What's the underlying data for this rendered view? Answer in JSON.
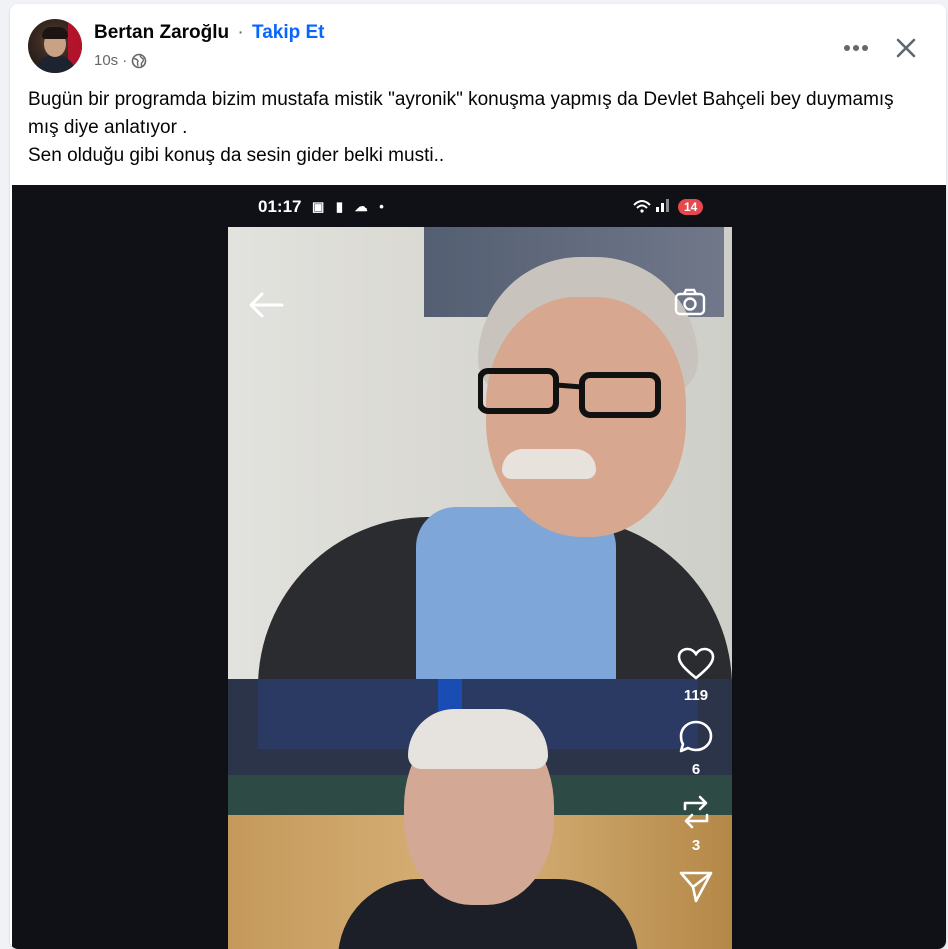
{
  "post": {
    "author": "Bertan Zaroğlu",
    "separator": "·",
    "follow_label": "Takip Et",
    "time": "10s",
    "time_separator": "·",
    "privacy_icon": "globe-icon",
    "text": "Bugün bir programda bizim mustafa mistik  \"ayronik\" konuşma yapmış da Devlet Bahçeli bey duymamış mış diye anlatıyor .\nSen olduğu gibi konuş da sesin gider belki musti.."
  },
  "header_actions": {
    "more_icon": "more-horizontal-icon",
    "close_icon": "close-icon"
  },
  "phone": {
    "status_time": "01:17",
    "status_battery": "14",
    "back_icon": "back-arrow-icon",
    "camera_icon": "camera-switch-icon",
    "likes": "119",
    "comments": "6",
    "reposts": "3",
    "actions_icons": [
      "heart-icon",
      "comment-icon",
      "repost-icon",
      "share-icon"
    ]
  },
  "colors": {
    "follow": "#0866ff",
    "text": "#050505",
    "meta": "#65676b",
    "media_bg": "#0f1116"
  }
}
